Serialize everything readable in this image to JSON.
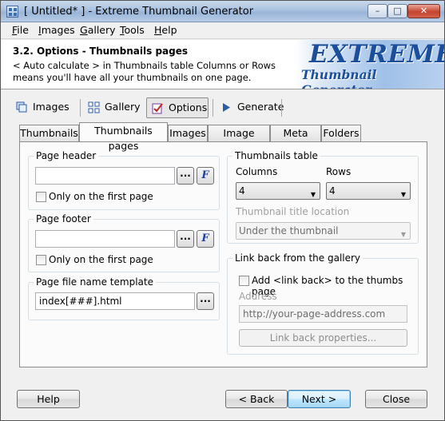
{
  "window": {
    "title": "[ Untitled* ] - Extreme Thumbnail Generator",
    "controls": {
      "minimize": "–",
      "maximize": "□",
      "close": "✕"
    }
  },
  "menu": [
    "File",
    "Images",
    "Gallery",
    "Tools",
    "Help"
  ],
  "header": {
    "title": "3.2. Options - Thumbnails pages",
    "description": "< Auto calculate > in Thumbnails table Columns or Rows means you'll have all your thumbnails on one page.",
    "logo_line1": "EXTREME",
    "logo_line2": "Thumbnail Generator"
  },
  "steps": [
    {
      "label": "Images",
      "icon": "images-icon"
    },
    {
      "label": "Gallery",
      "icon": "gallery-grid-icon"
    },
    {
      "label": "Options",
      "icon": "options-checkbox-icon",
      "active": true
    },
    {
      "label": "Generate",
      "icon": "play-arrow-icon"
    }
  ],
  "tabs": [
    "Thumbnails",
    "Thumbnails pages",
    "Images",
    "Image pages",
    "Meta data",
    "Folders"
  ],
  "active_tab": "Thumbnails pages",
  "page_header": {
    "label": "Page header",
    "value": "",
    "browse": "...",
    "format": "F",
    "checkbox_label": "Only on the first page",
    "checked": false
  },
  "page_footer": {
    "label": "Page footer",
    "value": "",
    "browse": "...",
    "format": "F",
    "checkbox_label": "Only on the first page",
    "checked": false
  },
  "file_name_template": {
    "label": "Page file name template",
    "value": "index[###].html",
    "browse": "..."
  },
  "thumbnails_table": {
    "label": "Thumbnails table",
    "columns_label": "Columns",
    "columns_value": "4",
    "rows_label": "Rows",
    "rows_value": "4",
    "title_location_label": "Thumbnail title location",
    "title_location_value": "Under the thumbnail"
  },
  "link_back": {
    "label": "Link back from the gallery",
    "checkbox_label": "Add <link back> to the thumbs page",
    "checked": false,
    "address_label": "Address",
    "address_placeholder": "http://your-page-address.com",
    "properties_button": "Link back properties..."
  },
  "footer": {
    "help": "Help",
    "back": "< Back",
    "next": "Next >",
    "close": "Close"
  }
}
